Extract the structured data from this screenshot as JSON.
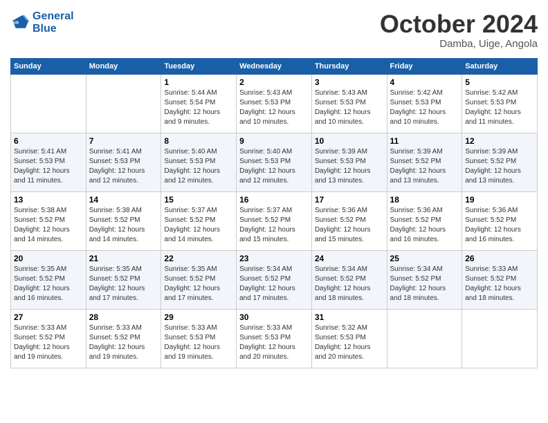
{
  "logo": {
    "line1": "General",
    "line2": "Blue"
  },
  "header": {
    "title": "October 2024",
    "subtitle": "Damba, Uige, Angola"
  },
  "weekdays": [
    "Sunday",
    "Monday",
    "Tuesday",
    "Wednesday",
    "Thursday",
    "Friday",
    "Saturday"
  ],
  "weeks": [
    [
      {
        "day": "",
        "info": ""
      },
      {
        "day": "",
        "info": ""
      },
      {
        "day": "1",
        "info": "Sunrise: 5:44 AM\nSunset: 5:54 PM\nDaylight: 12 hours and 9 minutes."
      },
      {
        "day": "2",
        "info": "Sunrise: 5:43 AM\nSunset: 5:53 PM\nDaylight: 12 hours and 10 minutes."
      },
      {
        "day": "3",
        "info": "Sunrise: 5:43 AM\nSunset: 5:53 PM\nDaylight: 12 hours and 10 minutes."
      },
      {
        "day": "4",
        "info": "Sunrise: 5:42 AM\nSunset: 5:53 PM\nDaylight: 12 hours and 10 minutes."
      },
      {
        "day": "5",
        "info": "Sunrise: 5:42 AM\nSunset: 5:53 PM\nDaylight: 12 hours and 11 minutes."
      }
    ],
    [
      {
        "day": "6",
        "info": "Sunrise: 5:41 AM\nSunset: 5:53 PM\nDaylight: 12 hours and 11 minutes."
      },
      {
        "day": "7",
        "info": "Sunrise: 5:41 AM\nSunset: 5:53 PM\nDaylight: 12 hours and 12 minutes."
      },
      {
        "day": "8",
        "info": "Sunrise: 5:40 AM\nSunset: 5:53 PM\nDaylight: 12 hours and 12 minutes."
      },
      {
        "day": "9",
        "info": "Sunrise: 5:40 AM\nSunset: 5:53 PM\nDaylight: 12 hours and 12 minutes."
      },
      {
        "day": "10",
        "info": "Sunrise: 5:39 AM\nSunset: 5:53 PM\nDaylight: 12 hours and 13 minutes."
      },
      {
        "day": "11",
        "info": "Sunrise: 5:39 AM\nSunset: 5:52 PM\nDaylight: 12 hours and 13 minutes."
      },
      {
        "day": "12",
        "info": "Sunrise: 5:39 AM\nSunset: 5:52 PM\nDaylight: 12 hours and 13 minutes."
      }
    ],
    [
      {
        "day": "13",
        "info": "Sunrise: 5:38 AM\nSunset: 5:52 PM\nDaylight: 12 hours and 14 minutes."
      },
      {
        "day": "14",
        "info": "Sunrise: 5:38 AM\nSunset: 5:52 PM\nDaylight: 12 hours and 14 minutes."
      },
      {
        "day": "15",
        "info": "Sunrise: 5:37 AM\nSunset: 5:52 PM\nDaylight: 12 hours and 14 minutes."
      },
      {
        "day": "16",
        "info": "Sunrise: 5:37 AM\nSunset: 5:52 PM\nDaylight: 12 hours and 15 minutes."
      },
      {
        "day": "17",
        "info": "Sunrise: 5:36 AM\nSunset: 5:52 PM\nDaylight: 12 hours and 15 minutes."
      },
      {
        "day": "18",
        "info": "Sunrise: 5:36 AM\nSunset: 5:52 PM\nDaylight: 12 hours and 16 minutes."
      },
      {
        "day": "19",
        "info": "Sunrise: 5:36 AM\nSunset: 5:52 PM\nDaylight: 12 hours and 16 minutes."
      }
    ],
    [
      {
        "day": "20",
        "info": "Sunrise: 5:35 AM\nSunset: 5:52 PM\nDaylight: 12 hours and 16 minutes."
      },
      {
        "day": "21",
        "info": "Sunrise: 5:35 AM\nSunset: 5:52 PM\nDaylight: 12 hours and 17 minutes."
      },
      {
        "day": "22",
        "info": "Sunrise: 5:35 AM\nSunset: 5:52 PM\nDaylight: 12 hours and 17 minutes."
      },
      {
        "day": "23",
        "info": "Sunrise: 5:34 AM\nSunset: 5:52 PM\nDaylight: 12 hours and 17 minutes."
      },
      {
        "day": "24",
        "info": "Sunrise: 5:34 AM\nSunset: 5:52 PM\nDaylight: 12 hours and 18 minutes."
      },
      {
        "day": "25",
        "info": "Sunrise: 5:34 AM\nSunset: 5:52 PM\nDaylight: 12 hours and 18 minutes."
      },
      {
        "day": "26",
        "info": "Sunrise: 5:33 AM\nSunset: 5:52 PM\nDaylight: 12 hours and 18 minutes."
      }
    ],
    [
      {
        "day": "27",
        "info": "Sunrise: 5:33 AM\nSunset: 5:52 PM\nDaylight: 12 hours and 19 minutes."
      },
      {
        "day": "28",
        "info": "Sunrise: 5:33 AM\nSunset: 5:52 PM\nDaylight: 12 hours and 19 minutes."
      },
      {
        "day": "29",
        "info": "Sunrise: 5:33 AM\nSunset: 5:53 PM\nDaylight: 12 hours and 19 minutes."
      },
      {
        "day": "30",
        "info": "Sunrise: 5:33 AM\nSunset: 5:53 PM\nDaylight: 12 hours and 20 minutes."
      },
      {
        "day": "31",
        "info": "Sunrise: 5:32 AM\nSunset: 5:53 PM\nDaylight: 12 hours and 20 minutes."
      },
      {
        "day": "",
        "info": ""
      },
      {
        "day": "",
        "info": ""
      }
    ]
  ]
}
